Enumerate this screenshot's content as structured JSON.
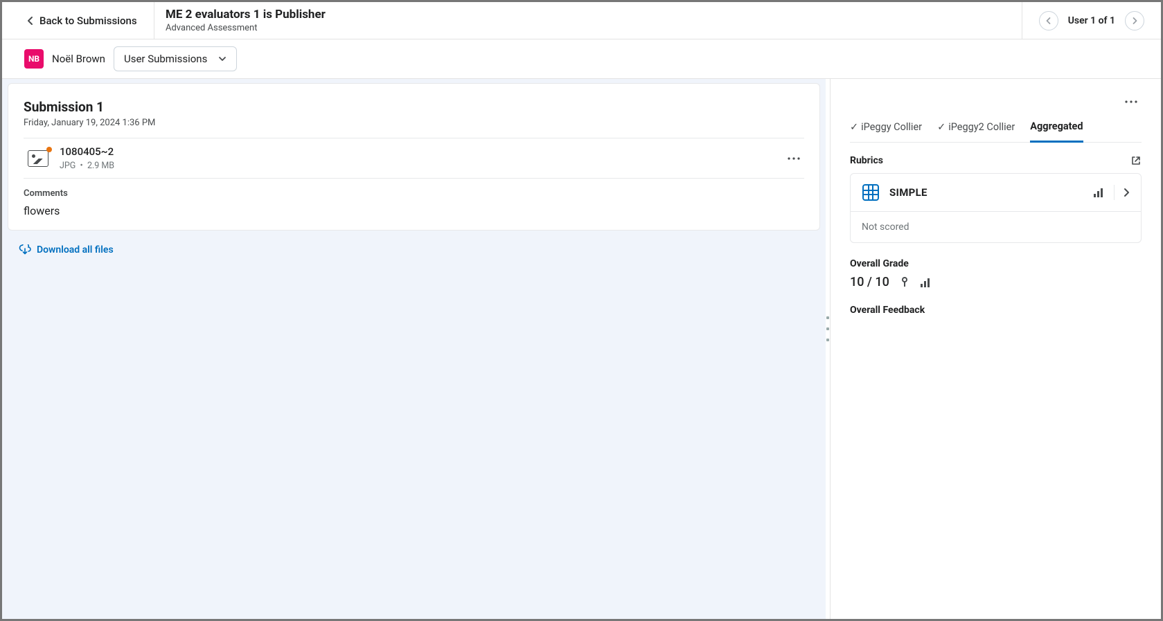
{
  "header": {
    "back_label": "Back to Submissions",
    "title": "ME 2 evaluators 1 is Publisher",
    "subtitle": "Advanced Assessment",
    "pager_text": "User 1 of 1"
  },
  "user_bar": {
    "avatar_initials": "NB",
    "user_name": "Noël Brown",
    "dropdown_label": "User Submissions"
  },
  "submission": {
    "title": "Submission 1",
    "timestamp": "Friday, January 19, 2024 1:36 PM",
    "file": {
      "name": "1080405~2",
      "type": "JPG",
      "separator": "•",
      "size": "2.9 MB"
    },
    "comments_label": "Comments",
    "comments_text": "flowers",
    "download_label": "Download all files"
  },
  "evaluation": {
    "tabs": [
      {
        "checked": true,
        "label": "iPeggy Collier"
      },
      {
        "checked": true,
        "label": "iPeggy2 Collier"
      },
      {
        "checked": false,
        "label": "Aggregated"
      }
    ],
    "active_tab_index": 2,
    "rubrics_label": "Rubrics",
    "rubric": {
      "name": "SIMPLE",
      "status": "Not scored"
    },
    "overall_grade_label": "Overall Grade",
    "overall_grade_value": "10 / 10",
    "overall_feedback_label": "Overall Feedback"
  }
}
